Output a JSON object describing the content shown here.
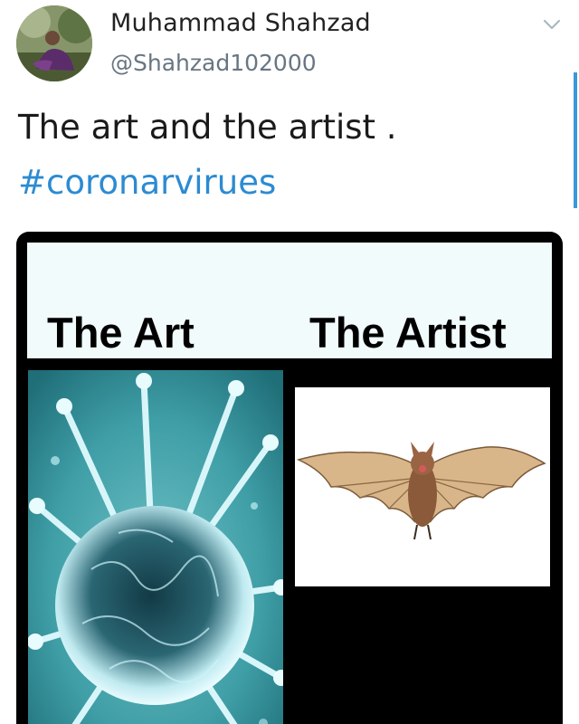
{
  "tweet": {
    "author_name": "Muhammad Shahzad",
    "author_handle": "@Shahzad102000",
    "text": "The art and the artist .",
    "hashtag": "#coronarvirues",
    "menu_icon": "chevron-down-icon",
    "avatar": "profile-photo"
  },
  "media": {
    "left_label": "The Art",
    "right_label": "The Artist",
    "left_image": "coronavirus-illustration",
    "right_image": "bat-photo"
  },
  "colors": {
    "hashtag": "#2c8bd2",
    "handle": "#687683",
    "scroll_indicator": "#3a99d8",
    "card_frame": "#000000",
    "header_panel": "#f1fbfc"
  }
}
